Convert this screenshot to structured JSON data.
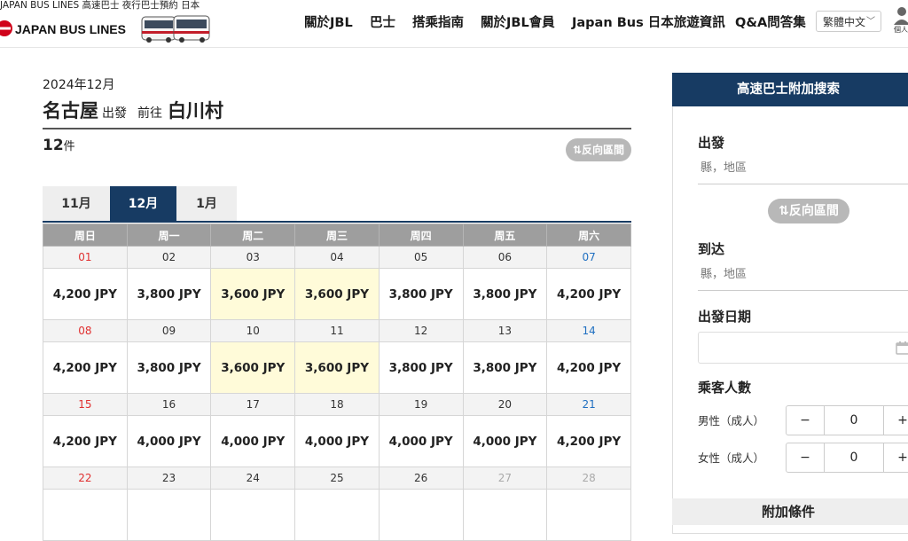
{
  "header": {
    "tagline": "JAPAN BUS LINES 高速巴士 夜行巴士預約 日本",
    "logo_text": "JAPAN BUS LINES",
    "nav": [
      "關於JBL",
      "巴士",
      "搭乘指南",
      "關於JBL會員",
      "Japan Bus 日本旅遊資訊",
      "Q&A問答集"
    ],
    "language": "繁體中文",
    "account_label": "個人"
  },
  "search_result": {
    "year_month": "2024年12月",
    "origin": "名古屋",
    "depart_label": "出發",
    "dest_prefix": "前往",
    "destination": "白川村",
    "count_num": "12",
    "count_unit": "件",
    "reverse_label": "⇅反向區間"
  },
  "month_tabs": [
    "11月",
    "12月",
    "1月"
  ],
  "active_month": 1,
  "calendar": {
    "weekdays": [
      "周日",
      "周一",
      "周二",
      "周三",
      "周四",
      "周五",
      "周六"
    ],
    "weeks": [
      {
        "dates": [
          "01",
          "02",
          "03",
          "04",
          "05",
          "06",
          "07"
        ],
        "prices": [
          "4,200 JPY",
          "3,800 JPY",
          "3,600 JPY",
          "3,600 JPY",
          "3,800 JPY",
          "3,800 JPY",
          "4,200 JPY"
        ]
      },
      {
        "dates": [
          "08",
          "09",
          "10",
          "11",
          "12",
          "13",
          "14"
        ],
        "prices": [
          "4,200 JPY",
          "3,800 JPY",
          "3,600 JPY",
          "3,600 JPY",
          "3,800 JPY",
          "3,800 JPY",
          "4,200 JPY"
        ]
      },
      {
        "dates": [
          "15",
          "16",
          "17",
          "18",
          "19",
          "20",
          "21"
        ],
        "prices": [
          "4,200 JPY",
          "4,000 JPY",
          "4,000 JPY",
          "4,000 JPY",
          "4,000 JPY",
          "4,000 JPY",
          "4,200 JPY"
        ]
      },
      {
        "dates": [
          "22",
          "23",
          "24",
          "25",
          "26",
          "27",
          "28"
        ],
        "prices": [
          "",
          "",
          "",
          "",
          "",
          "",
          ""
        ]
      }
    ],
    "colors": {
      "sunday": "#e03030",
      "saturday": "#1f6fc1",
      "cheapest_bg": "#fffbd9",
      "header_bg": "#9e9e9e",
      "accent": "#173b63"
    }
  },
  "side_panel": {
    "title": "高速巴士附加搜索",
    "departure_label": "出發",
    "departure_hint": "縣，地區",
    "reverse_label": "⇅反向區間",
    "arrival_label": "到达",
    "arrival_hint": "縣，地區",
    "date_label": "出發日期",
    "passengers_label": "乘客人數",
    "male_label": "男性（成人）",
    "male_count": "0",
    "female_label": "女性（成人）",
    "female_count": "0",
    "minus": "−",
    "plus": "+",
    "extra_label": "附加條件"
  }
}
